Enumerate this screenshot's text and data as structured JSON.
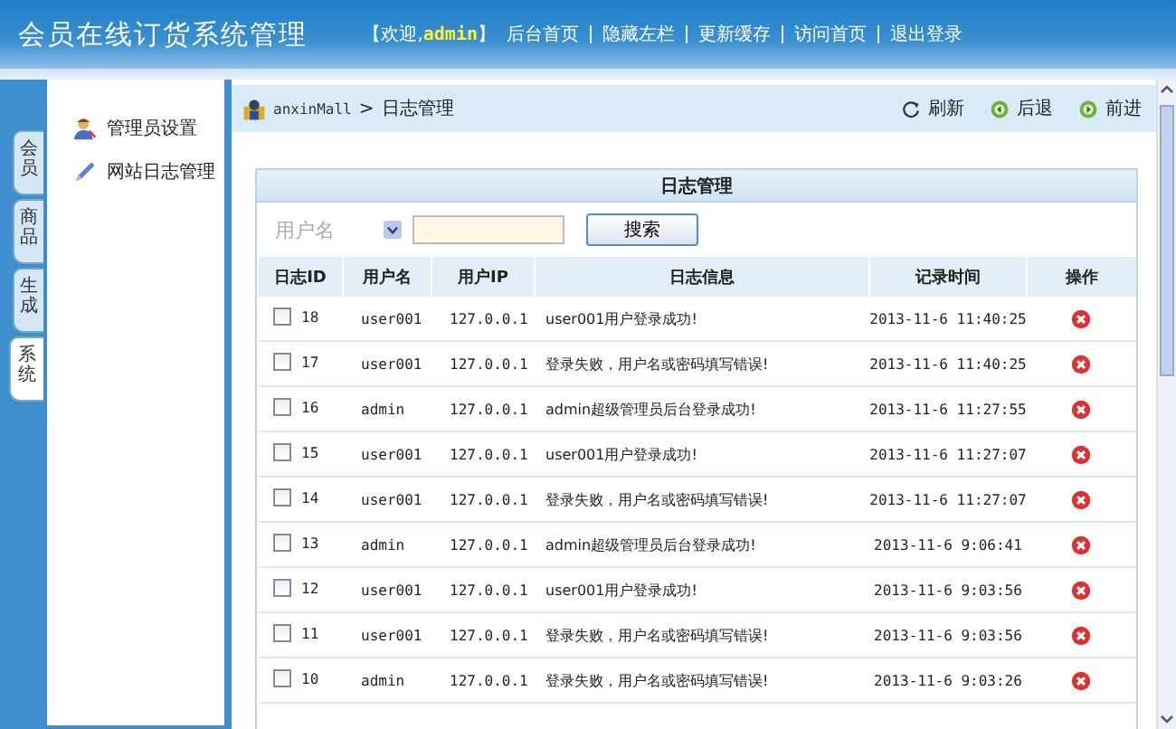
{
  "header": {
    "title": "会员在线订货系统管理",
    "welcome_prefix": "【欢迎,",
    "user": "admin",
    "welcome_suffix": "】",
    "links": [
      "后台首页",
      "隐藏左栏",
      "更新缓存",
      "访问首页",
      "退出登录"
    ]
  },
  "side_tabs": [
    {
      "label": "会员",
      "selected": false
    },
    {
      "label": "商品",
      "selected": false
    },
    {
      "label": "生成",
      "selected": false
    },
    {
      "label": "系统",
      "selected": true
    }
  ],
  "menu": [
    {
      "label": "管理员设置",
      "kind": "admin"
    },
    {
      "label": "网站日志管理",
      "kind": "log"
    }
  ],
  "breadcrumb": {
    "root": "anxinMall",
    "separator": ">",
    "current": "日志管理"
  },
  "toolbar": [
    {
      "label": "刷新",
      "kind": "refresh"
    },
    {
      "label": "后退",
      "kind": "back"
    },
    {
      "label": "前进",
      "kind": "forward"
    }
  ],
  "panel": {
    "title": "日志管理",
    "search": {
      "label": "用户名",
      "button": "搜索"
    }
  },
  "table": {
    "columns": [
      "日志ID",
      "用户名",
      "用户IP",
      "日志信息",
      "记录时间",
      "操作"
    ],
    "rows": [
      {
        "checked": false,
        "id": "18",
        "user": "user001",
        "ip": "127.0.0.1",
        "message": "user001用户登录成功!",
        "time": "2013-11-6 11:40:25"
      },
      {
        "checked": false,
        "id": "17",
        "user": "user001",
        "ip": "127.0.0.1",
        "message": "登录失败，用户名或密码填写错误!",
        "time": "2013-11-6 11:40:25"
      },
      {
        "checked": false,
        "id": "16",
        "user": "admin",
        "ip": "127.0.0.1",
        "message": "admin超级管理员后台登录成功!",
        "time": "2013-11-6 11:27:55"
      },
      {
        "checked": false,
        "id": "15",
        "user": "user001",
        "ip": "127.0.0.1",
        "message": "user001用户登录成功!",
        "time": "2013-11-6 11:27:07"
      },
      {
        "checked": false,
        "id": "14",
        "user": "user001",
        "ip": "127.0.0.1",
        "message": "登录失败，用户名或密码填写错误!",
        "time": "2013-11-6 11:27:07"
      },
      {
        "checked": false,
        "id": "13",
        "user": "admin",
        "ip": "127.0.0.1",
        "message": "admin超级管理员后台登录成功!",
        "time": "2013-11-6 9:06:41"
      },
      {
        "checked": false,
        "id": "12",
        "user": "user001",
        "ip": "127.0.0.1",
        "message": "user001用户登录成功!",
        "time": "2013-11-6 9:03:56"
      },
      {
        "checked": false,
        "id": "11",
        "user": "user001",
        "ip": "127.0.0.1",
        "message": "登录失败，用户名或密码填写错误!",
        "time": "2013-11-6 9:03:56"
      },
      {
        "checked": false,
        "id": "10",
        "user": "admin",
        "ip": "127.0.0.1",
        "message": "登录失败，用户名或密码填写错误!",
        "time": "2013-11-6 9:03:26"
      }
    ]
  }
}
